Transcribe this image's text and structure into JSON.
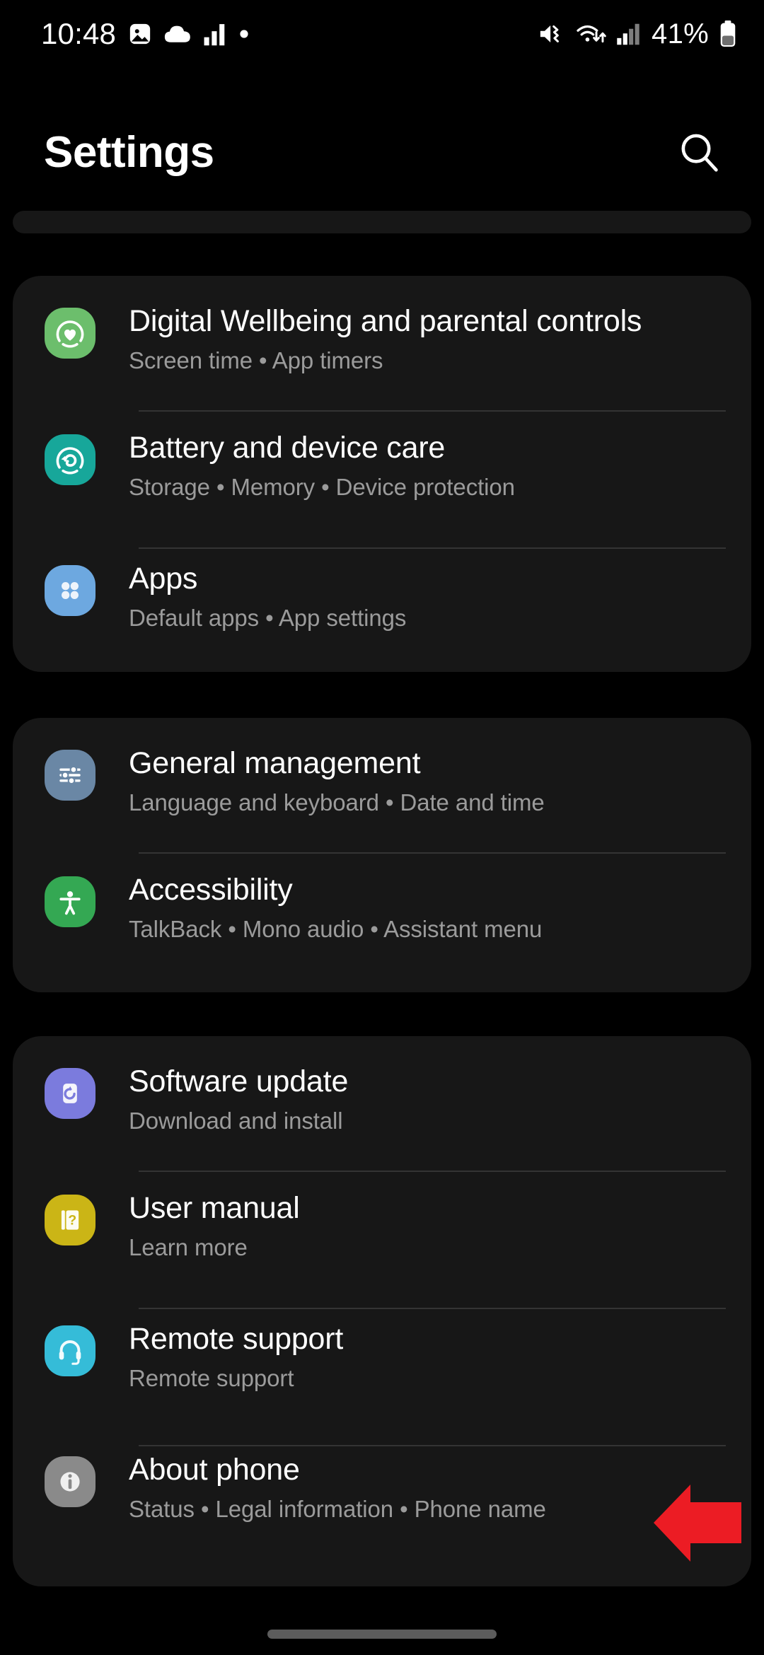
{
  "status_bar": {
    "clock": "10:48",
    "battery_percent": "41%",
    "left_icons": [
      "image-icon",
      "cloud-icon",
      "signal-bars-icon",
      "dot-icon"
    ],
    "right_icons": [
      "mute-icon",
      "wifi-data-icon",
      "cellular-signal-icon",
      "battery-icon"
    ]
  },
  "header": {
    "title": "Settings",
    "search_icon": "search-icon"
  },
  "groups": [
    {
      "id": "group-partial",
      "partial": true,
      "items": []
    },
    {
      "id": "group-device",
      "items": [
        {
          "title": "Digital Wellbeing and parental controls",
          "subtitle": "Screen time  •  App timers",
          "icon": "digital-wellbeing-icon",
          "icon_color": "#6cbe6c"
        },
        {
          "title": "Battery and device care",
          "subtitle": "Storage  •  Memory  •  Device protection",
          "icon": "battery-device-care-icon",
          "icon_color": "#17a79a"
        },
        {
          "title": "Apps",
          "subtitle": "Default apps  •  App settings",
          "icon": "apps-icon",
          "icon_color": "#6da8e0"
        }
      ]
    },
    {
      "id": "group-system",
      "items": [
        {
          "title": "General management",
          "subtitle": "Language and keyboard  •  Date and time",
          "icon": "sliders-icon",
          "icon_color": "#6a87a5"
        },
        {
          "title": "Accessibility",
          "subtitle": "TalkBack  •  Mono audio  •  Assistant menu",
          "icon": "accessibility-icon",
          "icon_color": "#34a853"
        }
      ]
    },
    {
      "id": "group-about",
      "items": [
        {
          "title": "Software update",
          "subtitle": "Download and install",
          "icon": "software-update-icon",
          "icon_color": "#7b7bdd"
        },
        {
          "title": "User manual",
          "subtitle": "Learn more",
          "icon": "user-manual-icon",
          "icon_color": "#cbb516"
        },
        {
          "title": "Remote support",
          "subtitle": "Remote support",
          "icon": "remote-support-icon",
          "icon_color": "#35bcd8"
        },
        {
          "title": "About phone",
          "subtitle": "Status  •  Legal information  •  Phone name",
          "icon": "about-phone-icon",
          "icon_color": "#8a8a8a"
        }
      ]
    }
  ],
  "annotation": {
    "type": "arrow-left",
    "color": "#ec1c24",
    "points_at": "About phone"
  },
  "navigation": {
    "gesture_bar": "home-gesture-bar"
  },
  "colors": {
    "background": "#000000",
    "card": "#171717",
    "divider": "#343434",
    "title_text": "#ffffff",
    "subtitle_text": "#9b9b9b"
  }
}
